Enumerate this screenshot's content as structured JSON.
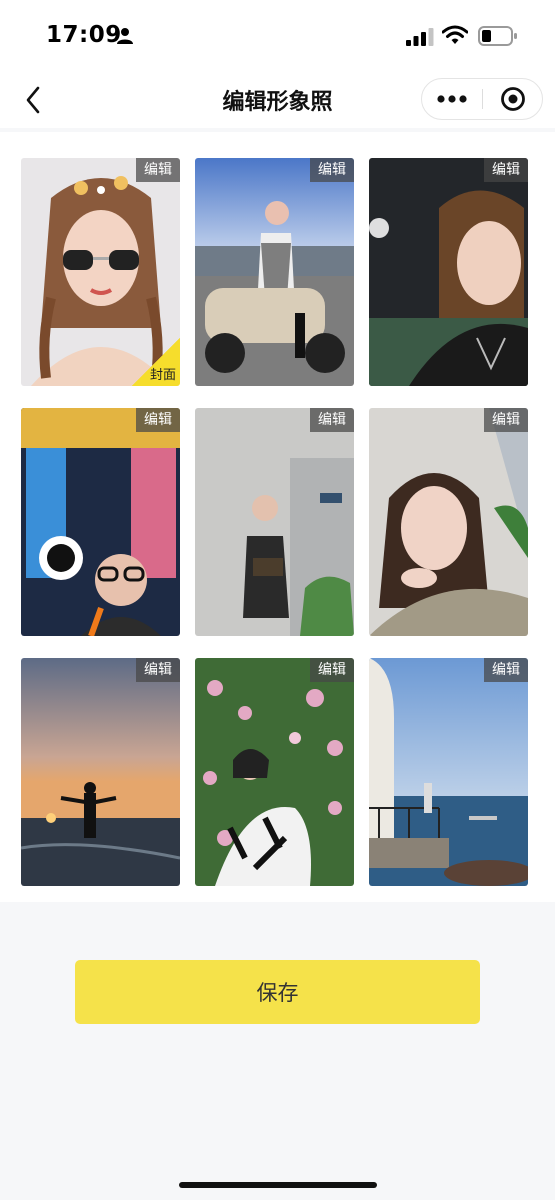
{
  "status_bar": {
    "time": "17:09"
  },
  "nav": {
    "title": "编辑形象照"
  },
  "photos": [
    {
      "edit_label": "编辑",
      "cover_label": "封面"
    },
    {
      "edit_label": "编辑"
    },
    {
      "edit_label": "编辑"
    },
    {
      "edit_label": "编辑"
    },
    {
      "edit_label": "编辑"
    },
    {
      "edit_label": "编辑"
    },
    {
      "edit_label": "编辑"
    },
    {
      "edit_label": "编辑"
    },
    {
      "edit_label": "编辑"
    }
  ],
  "footer": {
    "save_label": "保存"
  },
  "colors": {
    "accent": "#f5e24a",
    "badge_bg": "#464646",
    "page_bg": "#f6f7f9"
  }
}
